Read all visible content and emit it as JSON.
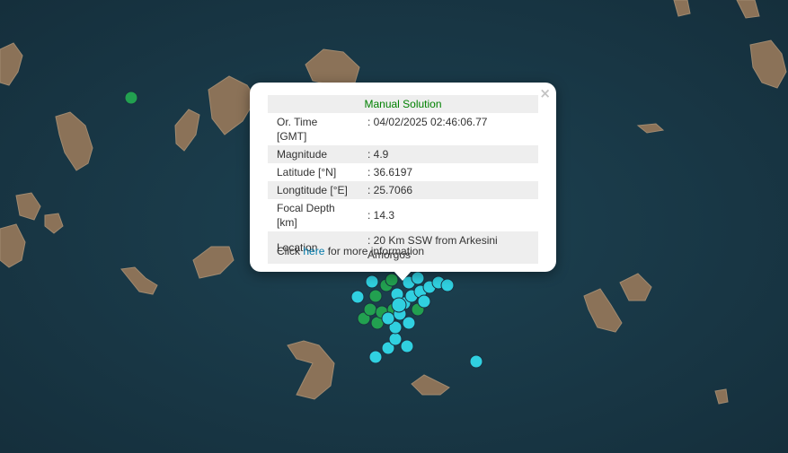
{
  "popup": {
    "title": "Manual Solution",
    "close_glyph": "×",
    "rows": [
      {
        "label": "Or. Time [GMT]",
        "value": ": 04/02/2025 02:46:06.77"
      },
      {
        "label": "Magnitude",
        "value": ": 4.9"
      },
      {
        "label": "Latitude [°N]",
        "value": ": 36.6197"
      },
      {
        "label": "Longtitude [°E]",
        "value": ": 25.7066"
      },
      {
        "label": "Focal Depth [km]",
        "value": ": 14.3"
      },
      {
        "label": "Location",
        "value": ": 20 Km SSW from Arkesini Amorgos"
      }
    ],
    "footer_prefix": "Click ",
    "footer_link": "here",
    "footer_suffix": " for more information"
  },
  "colors": {
    "sea": "#1c3d4c",
    "land": "#8a7057",
    "marker_cyan": "#30d0e0",
    "marker_green": "#22a050",
    "title_green": "#008000",
    "link": "#0078a8"
  }
}
